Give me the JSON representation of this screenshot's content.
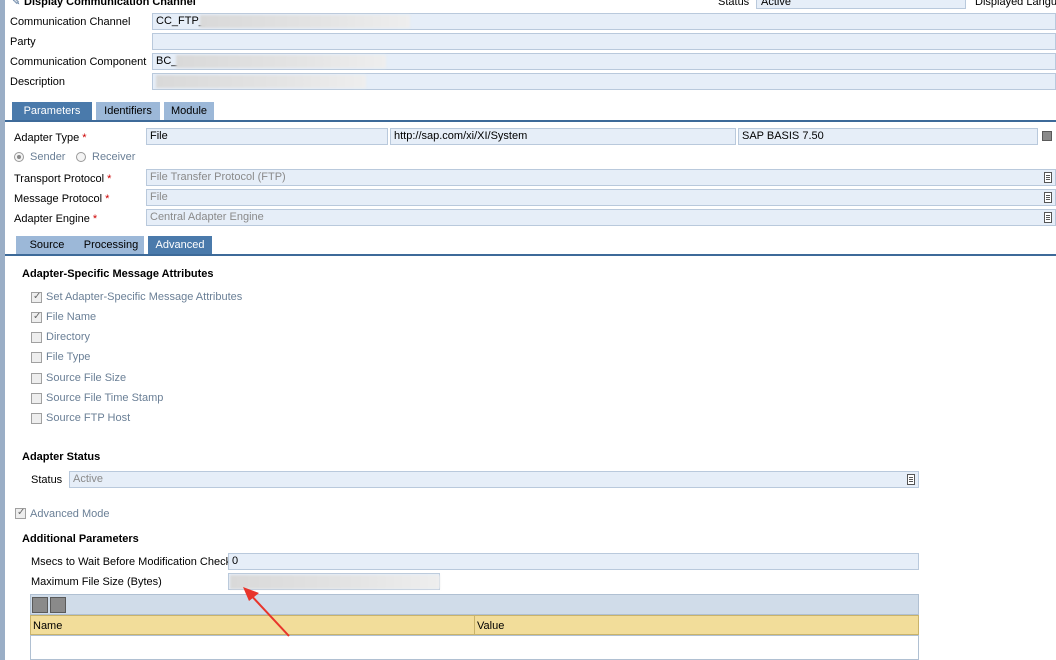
{
  "window": {
    "title": "Display Communication Channel",
    "status_label": "Status",
    "status_value": "Active",
    "displayed_language_label": "Displayed Langu"
  },
  "header": {
    "communication_channel_label": "Communication Channel",
    "communication_channel_value": "CC_FTP_",
    "party_label": "Party",
    "party_value": "",
    "communication_component_label": "Communication Component",
    "communication_component_value": "BC_",
    "description_label": "Description",
    "description_value": ""
  },
  "main_tabs": [
    {
      "label": "Parameters",
      "active": true
    },
    {
      "label": "Identifiers",
      "active": false
    },
    {
      "label": "Module",
      "active": false
    }
  ],
  "adapter": {
    "adapter_type_label": "Adapter Type",
    "adapter_type_value": "File",
    "namespace_value": "http://sap.com/xi/XI/System",
    "software_component_value": "SAP BASIS 7.50",
    "sender_label": "Sender",
    "receiver_label": "Receiver",
    "direction_selected": "Sender",
    "transport_protocol_label": "Transport Protocol",
    "transport_protocol_value": "File Transfer Protocol (FTP)",
    "message_protocol_label": "Message Protocol",
    "message_protocol_value": "File",
    "adapter_engine_label": "Adapter Engine",
    "adapter_engine_value": "Central Adapter Engine",
    "required_mark": "*"
  },
  "sub_tabs": [
    {
      "label": "Source",
      "active": false
    },
    {
      "label": "Processing",
      "active": false
    },
    {
      "label": "Advanced",
      "active": true
    }
  ],
  "asma": {
    "title": "Adapter-Specific Message Attributes",
    "options": [
      {
        "label": "Set Adapter-Specific Message Attributes",
        "checked": true
      },
      {
        "label": "File Name",
        "checked": true
      },
      {
        "label": "Directory",
        "checked": false
      },
      {
        "label": "File Type",
        "checked": false
      },
      {
        "label": "Source File Size",
        "checked": false
      },
      {
        "label": "Source File Time Stamp",
        "checked": false
      },
      {
        "label": "Source FTP Host",
        "checked": false
      }
    ]
  },
  "adapter_status": {
    "title": "Adapter Status",
    "status_label": "Status",
    "status_value": "Active"
  },
  "advanced_mode": {
    "label": "Advanced Mode",
    "checked": true
  },
  "additional_parameters": {
    "title": "Additional Parameters",
    "msecs_label": "Msecs to Wait Before Modification Check",
    "msecs_value": "0",
    "max_file_size_label": "Maximum File Size (Bytes)",
    "max_file_size_value": "",
    "table_columns": [
      "Name",
      "Value"
    ]
  },
  "colors": {
    "accent_tab": "#4a7aab",
    "inactive_tab": "#9cb8d8",
    "field_bg": "#e6eef8",
    "table_header": "#f2dd9a",
    "annotation_arrow": "#e8352b"
  }
}
